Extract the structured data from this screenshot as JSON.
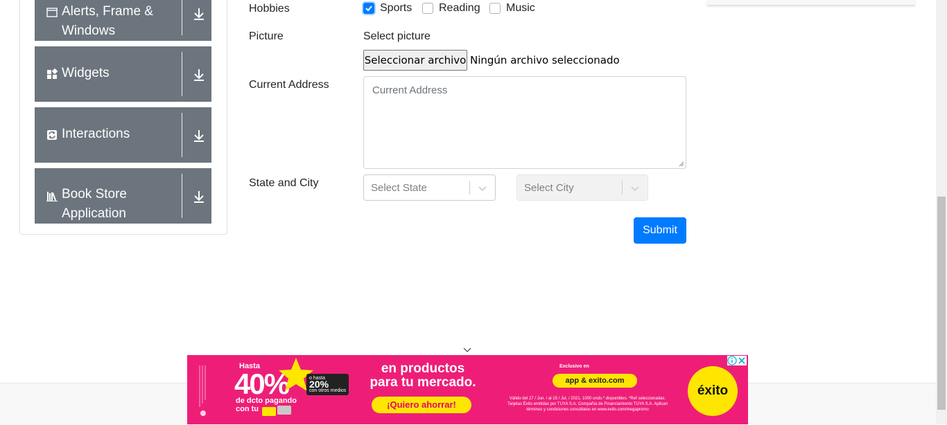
{
  "sidebar": {
    "groups": [
      {
        "label_line1": "Alerts, Frame &",
        "label_line2": "Windows",
        "icon": "window-icon"
      },
      {
        "label_line1": "Widgets",
        "icon": "widgets-icon"
      },
      {
        "label_line1": "Interactions",
        "icon": "interactions-icon"
      },
      {
        "label_line1": "Book Store",
        "label_line2": "Application",
        "icon": "book-store-icon"
      }
    ]
  },
  "form": {
    "hobbies_label": "Hobbies",
    "hobbies": [
      {
        "label": "Sports",
        "checked": true
      },
      {
        "label": "Reading",
        "checked": false
      },
      {
        "label": "Music",
        "checked": false
      }
    ],
    "picture_label": "Picture",
    "picture_hint": "Select picture",
    "file_button": "Seleccionar archivo",
    "file_status": "Ningún archivo seleccionado",
    "address_label": "Current Address",
    "address_placeholder": "Current Address",
    "state_city_label": "State and City",
    "state_placeholder": "Select State",
    "city_placeholder": "Select City",
    "submit_label": "Submit"
  },
  "ad": {
    "hasta": "Hasta",
    "percent": "40%",
    "badge_small": "o hasta",
    "badge_pct": "20%",
    "badge_rest": "con otros medios",
    "dcto_line1": "de dcto pagando",
    "dcto_line2": "con tu",
    "main_line1": "en productos",
    "main_line2": "para tu mercado.",
    "cta": "¡Quiero ahorrar!",
    "exclusivo": "Exclusivo en",
    "app": "app & exito.com",
    "legal": "Válido del 27 / Jun. / al 15 / Jul. / 2021. 1000 unds.* disponibles. *Ref seleccionadas. Tarjetas Éxito emitidas por TUYA S.A. Compañía de Financiamiento TUYA S.A. Aplican términos y condiciones consúltalos en www.exito.com/megapromo",
    "logo": "éxito"
  },
  "colors": {
    "sidebar_group_bg": "#6c757d",
    "primary": "#007bff",
    "ad_bg": "#ee1e78",
    "ad_yellow": "#ffe600"
  }
}
